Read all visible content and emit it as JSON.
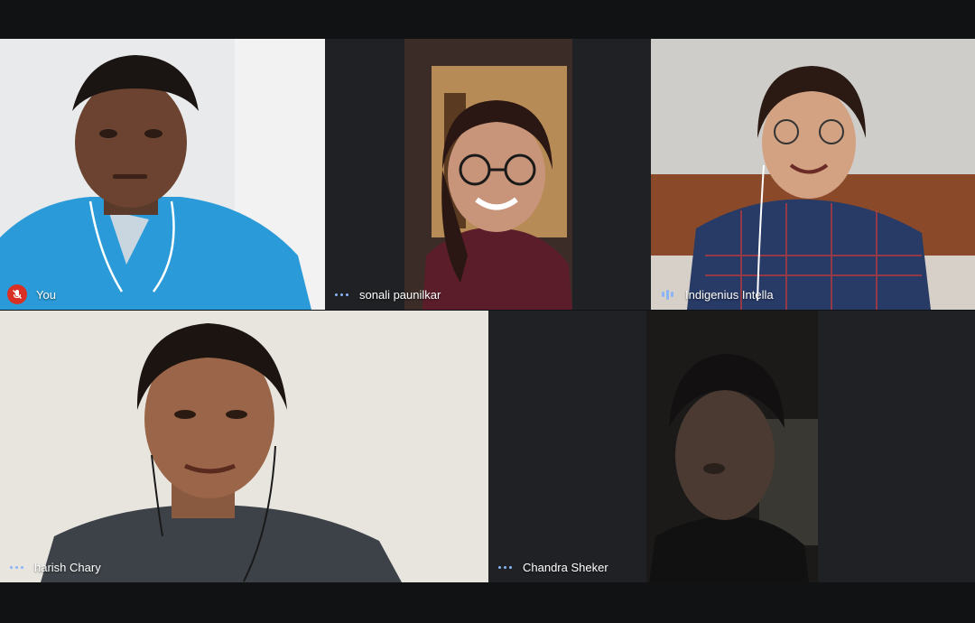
{
  "meeting": {
    "accent_color": "#8ab4f8",
    "muted_color": "#d93025",
    "participants": [
      {
        "name": "You",
        "status_icon": "mic-muted-icon"
      },
      {
        "name": "sonali paunilkar",
        "status_icon": "more-dots-icon"
      },
      {
        "name": "Indigenius Intella",
        "status_icon": "audio-level-icon"
      },
      {
        "name": "harish Chary",
        "status_icon": "more-dots-icon"
      },
      {
        "name": "Chandra Sheker",
        "status_icon": "more-dots-icon"
      }
    ]
  }
}
